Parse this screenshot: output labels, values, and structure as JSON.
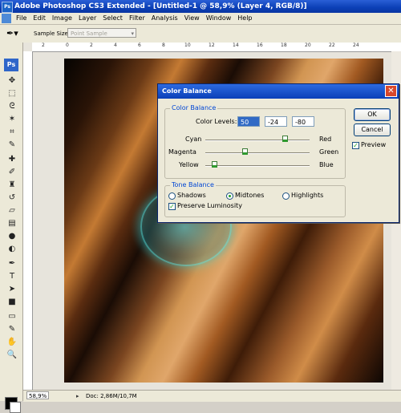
{
  "window": {
    "title": "Adobe Photoshop CS3 Extended - [Untitled-1 @ 58,9% (Layer 4, RGB/8)]",
    "app_badge": "Ps"
  },
  "menu": [
    "File",
    "Edit",
    "Image",
    "Layer",
    "Select",
    "Filter",
    "Analysis",
    "View",
    "Window",
    "Help"
  ],
  "options": {
    "tool_icon": "eyedropper-icon",
    "sample_size_label": "Sample Size:",
    "sample_size_value": "Point Sample"
  },
  "toolbox": {
    "logo": "Ps",
    "tools": [
      "move-icon",
      "marquee-icon",
      "lasso-icon",
      "magic-wand-icon",
      "crop-icon",
      "slice-icon",
      "healing-brush-icon",
      "brush-icon",
      "clone-stamp-icon",
      "history-brush-icon",
      "eraser-icon",
      "gradient-icon",
      "blur-icon",
      "dodge-icon",
      "pen-icon",
      "type-icon",
      "path-selection-icon",
      "shape-icon",
      "notes-icon",
      "eyedropper-icon",
      "hand-icon",
      "zoom-icon"
    ]
  },
  "ruler": {
    "top_numbers": [
      "2",
      "0",
      "2",
      "4",
      "6",
      "8",
      "10",
      "12",
      "14",
      "16",
      "18",
      "20",
      "22",
      "24"
    ]
  },
  "status": {
    "zoom": "58,9%",
    "doc": "Doc: 2,86M/10,7M"
  },
  "dialog": {
    "title": "Color Balance",
    "color_balance_group": "Color Balance",
    "color_levels_label": "Color Levels:",
    "levels": [
      "50",
      "-24",
      "-80"
    ],
    "sliders": [
      {
        "left": "Cyan",
        "right": "Red",
        "value": 50
      },
      {
        "left": "Magenta",
        "right": "Green",
        "value": -24
      },
      {
        "left": "Yellow",
        "right": "Blue",
        "value": -80
      }
    ],
    "tone_balance_group": "Tone Balance",
    "tones": [
      "Shadows",
      "Midtones",
      "Highlights"
    ],
    "tone_selected": "Midtones",
    "preserve_luminosity": "Preserve Luminosity",
    "preserve_checked": true,
    "ok": "OK",
    "cancel": "Cancel",
    "preview": "Preview",
    "preview_checked": true
  }
}
